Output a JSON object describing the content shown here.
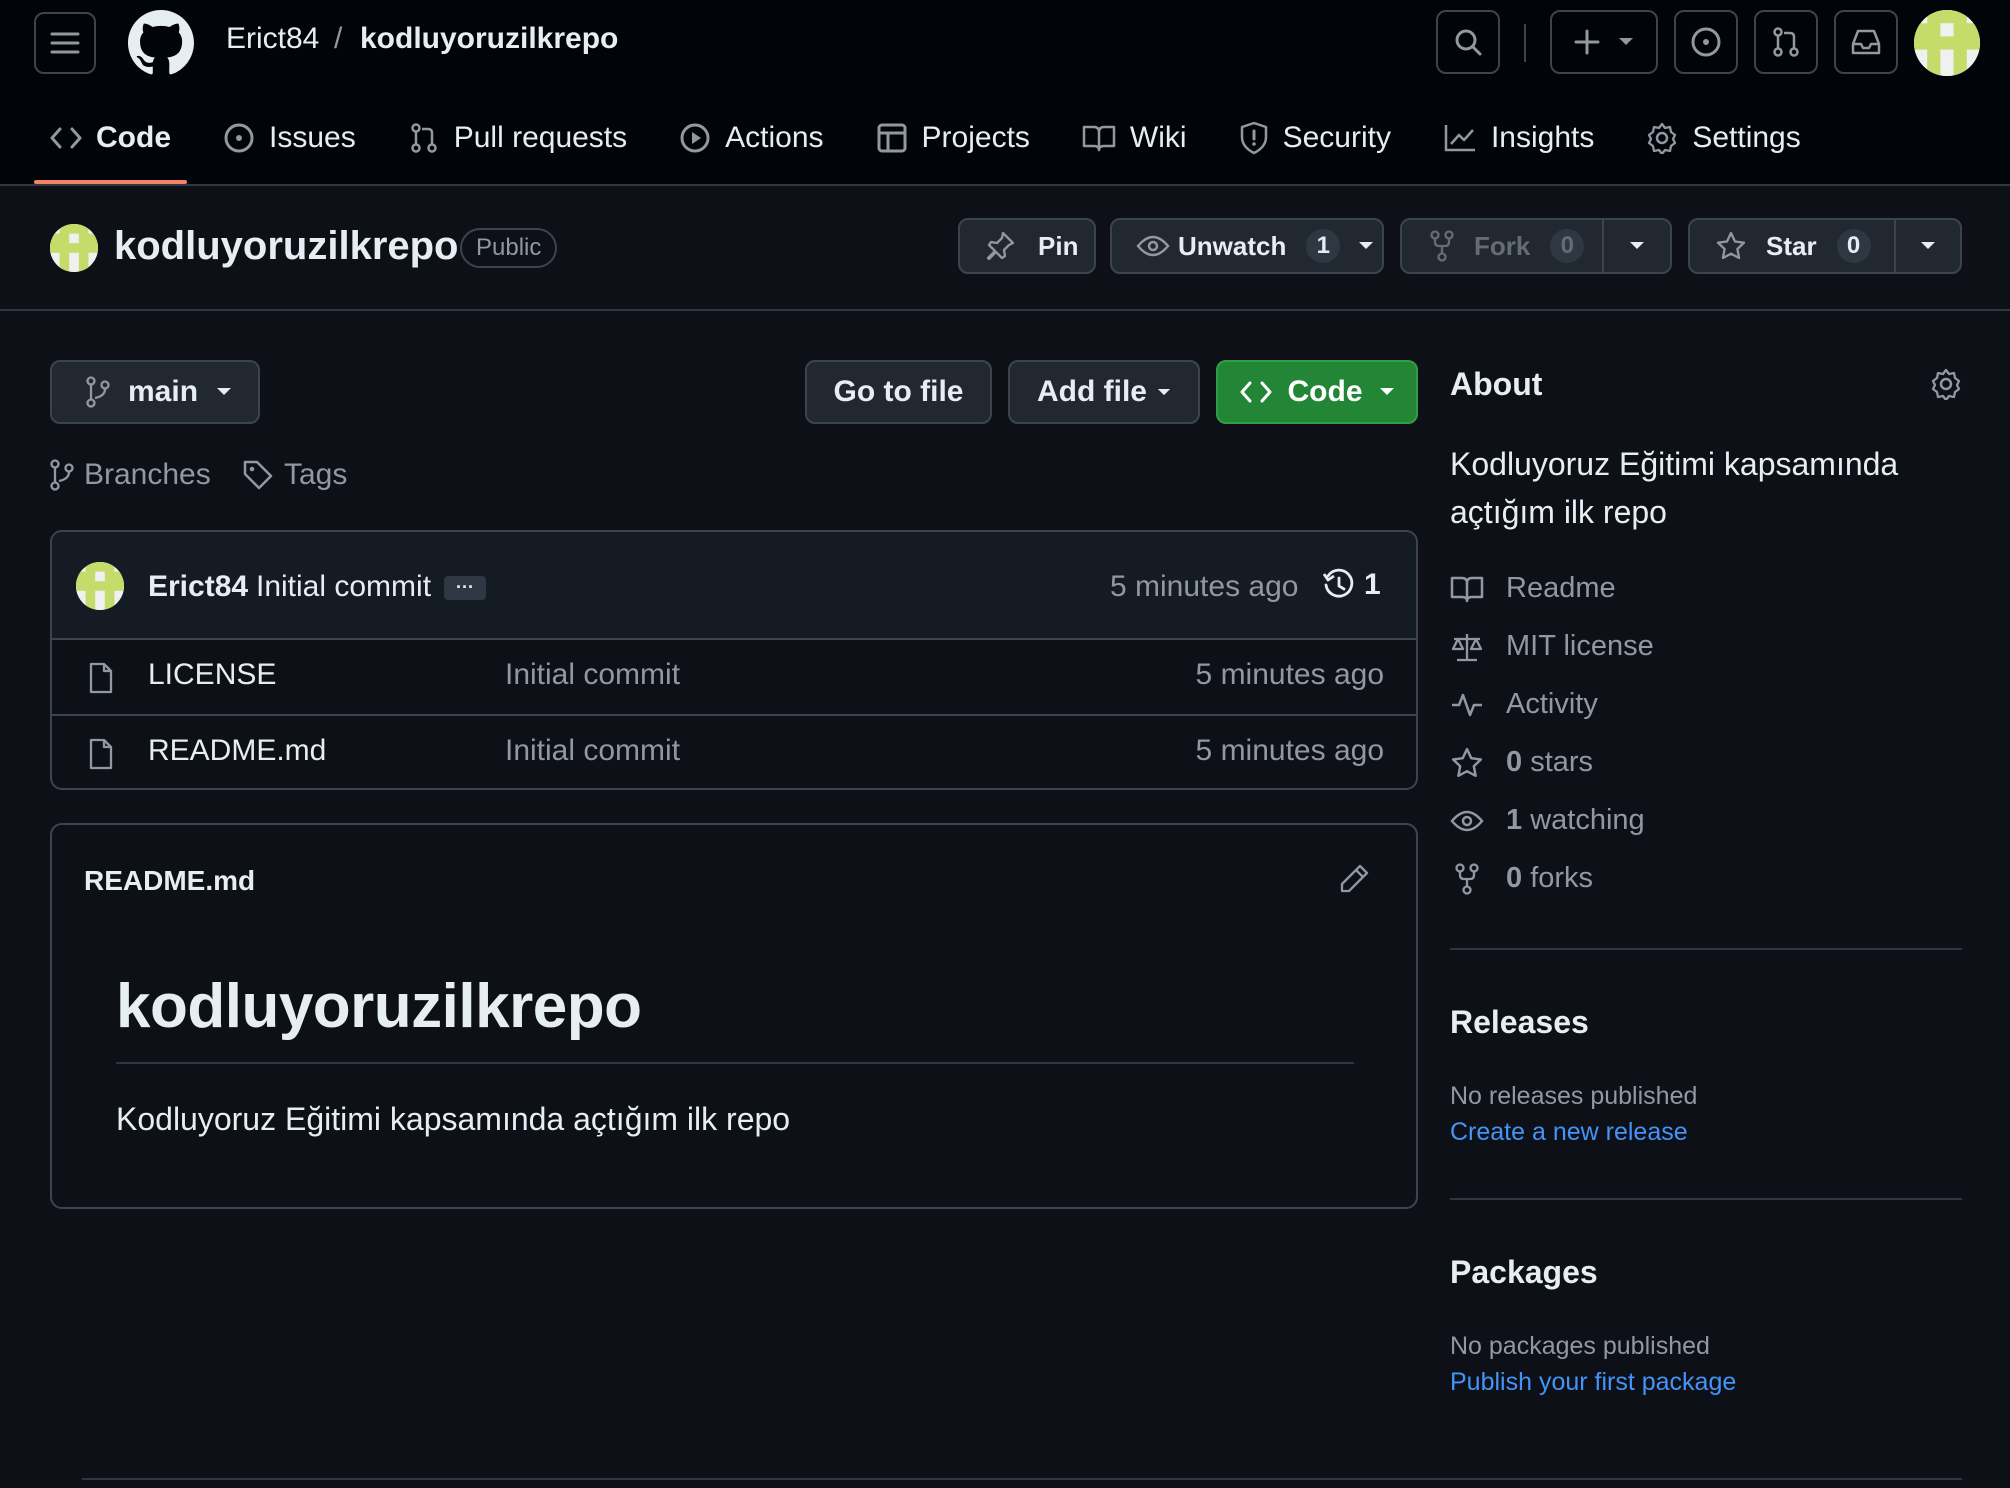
{
  "header": {
    "owner": "Erict84",
    "separator": "/",
    "repo": "kodluyoruzilkrepo"
  },
  "tabs": [
    {
      "label": "Code",
      "icon": "code-icon",
      "active": true
    },
    {
      "label": "Issues",
      "icon": "issue-icon"
    },
    {
      "label": "Pull requests",
      "icon": "pull-request-icon"
    },
    {
      "label": "Actions",
      "icon": "play-icon"
    },
    {
      "label": "Projects",
      "icon": "table-icon"
    },
    {
      "label": "Wiki",
      "icon": "book-icon"
    },
    {
      "label": "Security",
      "icon": "shield-icon"
    },
    {
      "label": "Insights",
      "icon": "graph-icon"
    },
    {
      "label": "Settings",
      "icon": "gear-icon"
    }
  ],
  "repo_header": {
    "name": "kodluyoruzilkrepo",
    "visibility": "Public",
    "pin_label": "Pin",
    "unwatch_label": "Unwatch",
    "watch_count": "1",
    "fork_label": "Fork",
    "fork_count": "0",
    "star_label": "Star",
    "star_count": "0"
  },
  "toolbar": {
    "branch": "main",
    "goto_file": "Go to file",
    "add_file": "Add file",
    "code": "Code",
    "branches": "Branches",
    "tags": "Tags"
  },
  "last_commit": {
    "author": "Erict84",
    "message": "Initial commit",
    "ellipsis": "···",
    "time": "5 minutes ago",
    "commit_count": "1"
  },
  "files": [
    {
      "name": "LICENSE",
      "message": "Initial commit",
      "time": "5 minutes ago"
    },
    {
      "name": "README.md",
      "message": "Initial commit",
      "time": "5 minutes ago"
    }
  ],
  "readme": {
    "filename": "README.md",
    "heading": "kodluyoruzilkrepo",
    "body": "Kodluyoruz Eğitimi kapsamında açtığım ilk repo"
  },
  "about": {
    "title": "About",
    "description": "Kodluyoruz Eğitimi kapsamında açtığım ilk repo",
    "readme": "Readme",
    "license": "MIT license",
    "activity": "Activity",
    "stars_count": "0",
    "stars_label": "stars",
    "watching_count": "1",
    "watching_label": "watching",
    "forks_count": "0",
    "forks_label": "forks"
  },
  "releases": {
    "title": "Releases",
    "empty": "No releases published",
    "link": "Create a new release"
  },
  "packages": {
    "title": "Packages",
    "empty": "No packages published",
    "link": "Publish your first package"
  },
  "colors": {
    "background": "#0d1117",
    "header_bg": "#010409",
    "accent_tab": "#f78166",
    "code_button": "#238636",
    "link": "#4493f8",
    "avatar": "#c5dc6a"
  }
}
